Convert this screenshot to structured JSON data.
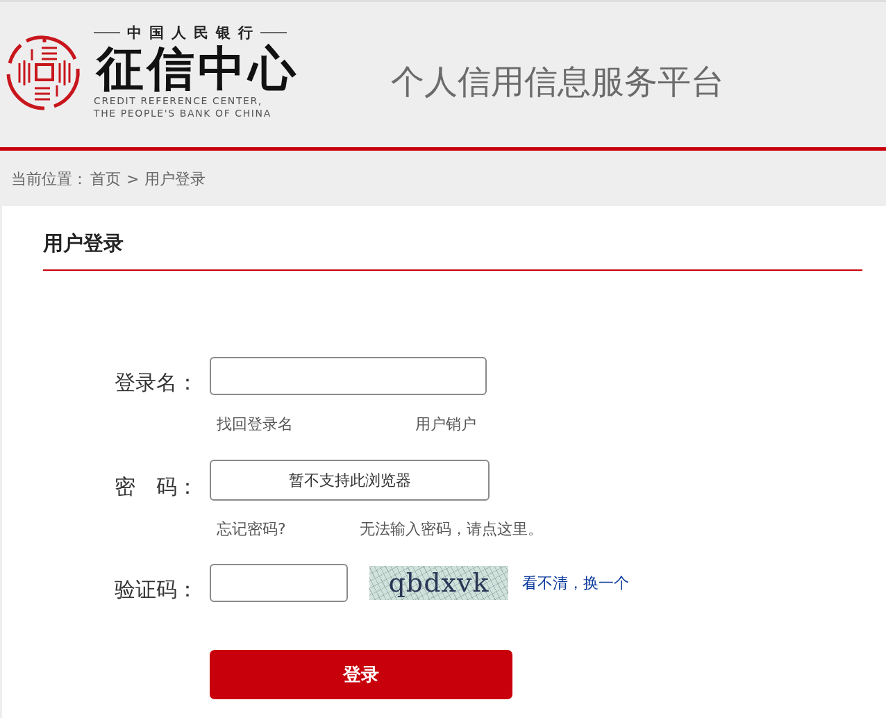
{
  "header": {
    "logo": {
      "top_line": "中国人民银行",
      "name": "征信中心",
      "english_lines": [
        "CREDIT REFERENCE CENTER,",
        "THE PEOPLE'S BANK OF CHINA"
      ]
    },
    "title": "个人信用信息服务平台"
  },
  "breadcrumb": {
    "label": "当前位置：",
    "items": [
      "首页",
      "用户登录"
    ],
    "separator": ">"
  },
  "login": {
    "title": "用户登录",
    "fields": [
      {
        "kind": "text",
        "label": "登录名：",
        "links": [
          "找回登录名",
          "用户销户"
        ]
      },
      {
        "kind": "notice",
        "label": "密　码：",
        "message": "暂不支持此浏览器",
        "links": [
          "忘记密码?",
          "无法输入密码，请点这里。"
        ]
      },
      {
        "kind": "captcha",
        "label": "验证码：",
        "captcha": "qbdxvk",
        "refresh_link": "看不清，换一个"
      }
    ],
    "submit": "登录"
  }
}
